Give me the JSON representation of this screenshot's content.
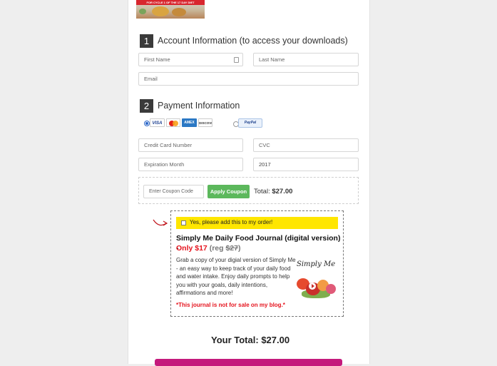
{
  "banner": {
    "caption": "FOR CYCLE 1 OF THE 17 DAY DIET"
  },
  "account": {
    "number": "1",
    "title": "Account Information (to access your downloads)",
    "first_name_placeholder": "First Name",
    "last_name_placeholder": "Last Name",
    "email_placeholder": "Email"
  },
  "payment": {
    "number": "2",
    "title": "Payment Information",
    "methods": {
      "card_selected": true,
      "card_logos": [
        "VISA",
        "MasterCard",
        "AMERICAN EXPRESS",
        "DISCOVER"
      ],
      "paypal_label": "PayPal"
    },
    "card_number_placeholder": "Credit Card Number",
    "cvc_placeholder": "CVC",
    "expiration_month_placeholder": "Expiration Month",
    "expiration_year_value": "2017"
  },
  "coupon": {
    "placeholder": "Enter Coupon Code",
    "apply_label": "Apply Coupon",
    "total_label": "Total:",
    "total_value": "$27.00"
  },
  "offer": {
    "checkbox_label": "Yes, please add this to my order!",
    "checked": false,
    "title": "Simply Me Daily Food Journal (digital version) -",
    "price_prefix": "Only $17",
    "reg_open": "(reg ",
    "reg_price": "$27",
    "reg_close": ")",
    "description": "Grab a copy of your digial version of Simply Me - an easy way to keep track of your daily food and water intake. Enjoy daily prompts to help you with your goals, daily intentions, affirmations and more!",
    "note": "*This journal is not for sale on my blog.*",
    "image_title": "Simply Me"
  },
  "summary": {
    "label": "Your Total:",
    "value": "$27.00"
  },
  "colors": {
    "apply_button": "#5cb85c",
    "offer_highlight": "#ffe600",
    "price_red": "#e5131d",
    "order_button": "#c4197c"
  }
}
